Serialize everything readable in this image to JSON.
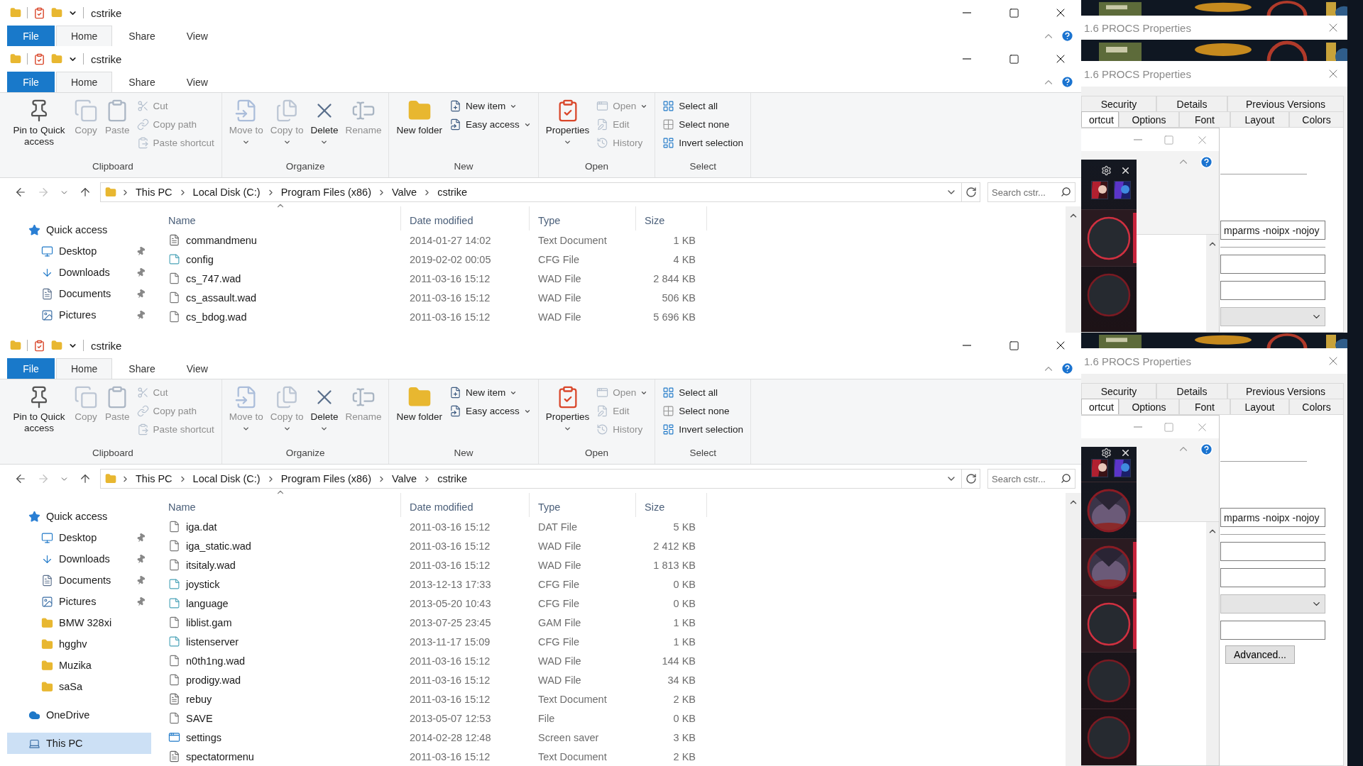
{
  "explorers": [
    {
      "title": "cstrike",
      "tabs": [
        {
          "label": "File",
          "kind": "file",
          "selected": false
        },
        {
          "label": "Home",
          "kind": "tab",
          "selected": true
        },
        {
          "label": "Share",
          "kind": "tab",
          "selected": false
        },
        {
          "label": "View",
          "kind": "tab",
          "selected": false
        }
      ]
    },
    {
      "title": "cstrike",
      "tabs": [
        {
          "label": "File",
          "kind": "file",
          "selected": false
        },
        {
          "label": "Home",
          "kind": "tab",
          "selected": true
        },
        {
          "label": "Share",
          "kind": "tab",
          "selected": false
        },
        {
          "label": "View",
          "kind": "tab",
          "selected": false
        }
      ],
      "ribbon": [
        {
          "label": "Clipboard",
          "large": [
            {
              "label": "Pin to Quick access",
              "kind": "pin",
              "disabled": false,
              "dropdown": false
            },
            {
              "label": "Copy",
              "kind": "copy",
              "disabled": true,
              "dropdown": false
            },
            {
              "label": "Paste",
              "kind": "paste",
              "disabled": true,
              "dropdown": false
            }
          ],
          "small": [
            {
              "label": "Cut",
              "kind": "cut",
              "disabled": true,
              "dropdown": false
            },
            {
              "label": "Copy path",
              "kind": "copypath",
              "disabled": true,
              "dropdown": false
            },
            {
              "label": "Paste shortcut",
              "kind": "shortcut",
              "disabled": true,
              "dropdown": false
            }
          ]
        },
        {
          "label": "Organize",
          "large": [
            {
              "label": "Move to",
              "kind": "moveto",
              "disabled": true,
              "dropdown": true
            },
            {
              "label": "Copy to",
              "kind": "copyto",
              "disabled": true,
              "dropdown": true
            },
            {
              "label": "Delete",
              "kind": "delete",
              "disabled": false,
              "dropdown": true
            },
            {
              "label": "Rename",
              "kind": "rename",
              "disabled": true,
              "dropdown": false
            }
          ]
        },
        {
          "label": "New",
          "large": [
            {
              "label": "New folder",
              "kind": "newfolder",
              "disabled": false,
              "dropdown": false
            }
          ],
          "small": [
            {
              "label": "New item",
              "kind": "newitem",
              "disabled": false,
              "dropdown": true
            },
            {
              "label": "Easy access",
              "kind": "easyaccess",
              "disabled": false,
              "dropdown": true
            }
          ]
        },
        {
          "label": "Open",
          "large": [
            {
              "label": "Properties",
              "kind": "properties",
              "disabled": false,
              "dropdown": true
            }
          ],
          "small": [
            {
              "label": "Open",
              "kind": "open",
              "disabled": true,
              "dropdown": true
            },
            {
              "label": "Edit",
              "kind": "edit",
              "disabled": true,
              "dropdown": false
            },
            {
              "label": "History",
              "kind": "history",
              "disabled": true,
              "dropdown": false
            }
          ]
        },
        {
          "label": "Select",
          "small": [
            {
              "label": "Select all",
              "kind": "selectall",
              "disabled": false,
              "dropdown": false
            },
            {
              "label": "Select none",
              "kind": "selectnone",
              "disabled": false,
              "dropdown": false
            },
            {
              "label": "Invert selection",
              "kind": "invert",
              "disabled": false,
              "dropdown": false
            }
          ]
        }
      ],
      "nav_buttons": [
        {
          "kind": "back",
          "disabled": false
        },
        {
          "kind": "forward",
          "disabled": true
        },
        {
          "kind": "recent",
          "disabled": false
        },
        {
          "kind": "up",
          "disabled": false
        }
      ],
      "crumbs": [
        "This PC",
        "Local Disk (C:)",
        "Program Files (x86)",
        "Valve",
        "cstrike"
      ],
      "search_placeholder": "Search cstr...",
      "nav": [
        {
          "label": "Quick access",
          "kind": "star",
          "pinned": false,
          "selected": false,
          "children": [
            {
              "label": "Desktop",
              "kind": "desktop",
              "pinned": true,
              "selected": false
            },
            {
              "label": "Downloads",
              "kind": "downloads",
              "pinned": true,
              "selected": false
            },
            {
              "label": "Documents",
              "kind": "documents",
              "pinned": true,
              "selected": false
            },
            {
              "label": "Pictures",
              "kind": "pictures",
              "pinned": true,
              "selected": false
            }
          ]
        }
      ],
      "columns": [
        {
          "label": "Name",
          "sorted": true
        },
        {
          "label": "Date modified",
          "sorted": false
        },
        {
          "label": "Type",
          "sorted": false
        },
        {
          "label": "Size",
          "sorted": false
        }
      ],
      "rows": [
        {
          "name": "commandmenu",
          "date": "2014-01-27 14:02",
          "type": "Text Document",
          "size": "1 KB",
          "kind": "text"
        },
        {
          "name": "config",
          "date": "2019-02-02 00:05",
          "type": "CFG File",
          "size": "4 KB",
          "kind": "cfg"
        },
        {
          "name": "cs_747.wad",
          "date": "2011-03-16 15:12",
          "type": "WAD File",
          "size": "2 844 KB",
          "kind": "file"
        },
        {
          "name": "cs_assault.wad",
          "date": "2011-03-16 15:12",
          "type": "WAD File",
          "size": "506 KB",
          "kind": "file"
        },
        {
          "name": "cs_bdog.wad",
          "date": "2011-03-16 15:12",
          "type": "WAD File",
          "size": "5 696 KB",
          "kind": "file"
        }
      ]
    },
    {
      "title": "cstrike",
      "tabs": [
        {
          "label": "File",
          "kind": "file",
          "selected": false
        },
        {
          "label": "Home",
          "kind": "tab",
          "selected": true
        },
        {
          "label": "Share",
          "kind": "tab",
          "selected": false
        },
        {
          "label": "View",
          "kind": "tab",
          "selected": false
        }
      ],
      "ribbon": [
        {
          "label": "Clipboard",
          "large": [
            {
              "label": "Pin to Quick access",
              "kind": "pin",
              "disabled": false,
              "dropdown": false
            },
            {
              "label": "Copy",
              "kind": "copy",
              "disabled": true,
              "dropdown": false
            },
            {
              "label": "Paste",
              "kind": "paste",
              "disabled": true,
              "dropdown": false
            }
          ],
          "small": [
            {
              "label": "Cut",
              "kind": "cut",
              "disabled": true,
              "dropdown": false
            },
            {
              "label": "Copy path",
              "kind": "copypath",
              "disabled": true,
              "dropdown": false
            },
            {
              "label": "Paste shortcut",
              "kind": "shortcut",
              "disabled": true,
              "dropdown": false
            }
          ]
        },
        {
          "label": "Organize",
          "large": [
            {
              "label": "Move to",
              "kind": "moveto",
              "disabled": true,
              "dropdown": true
            },
            {
              "label": "Copy to",
              "kind": "copyto",
              "disabled": true,
              "dropdown": true
            },
            {
              "label": "Delete",
              "kind": "delete",
              "disabled": false,
              "dropdown": true
            },
            {
              "label": "Rename",
              "kind": "rename",
              "disabled": true,
              "dropdown": false
            }
          ]
        },
        {
          "label": "New",
          "large": [
            {
              "label": "New folder",
              "kind": "newfolder",
              "disabled": false,
              "dropdown": false
            }
          ],
          "small": [
            {
              "label": "New item",
              "kind": "newitem",
              "disabled": false,
              "dropdown": true
            },
            {
              "label": "Easy access",
              "kind": "easyaccess",
              "disabled": false,
              "dropdown": true
            }
          ]
        },
        {
          "label": "Open",
          "large": [
            {
              "label": "Properties",
              "kind": "properties",
              "disabled": false,
              "dropdown": true
            }
          ],
          "small": [
            {
              "label": "Open",
              "kind": "open",
              "disabled": true,
              "dropdown": true
            },
            {
              "label": "Edit",
              "kind": "edit",
              "disabled": true,
              "dropdown": false
            },
            {
              "label": "History",
              "kind": "history",
              "disabled": true,
              "dropdown": false
            }
          ]
        },
        {
          "label": "Select",
          "small": [
            {
              "label": "Select all",
              "kind": "selectall",
              "disabled": false,
              "dropdown": false
            },
            {
              "label": "Select none",
              "kind": "selectnone",
              "disabled": false,
              "dropdown": false
            },
            {
              "label": "Invert selection",
              "kind": "invert",
              "disabled": false,
              "dropdown": false
            }
          ]
        }
      ],
      "nav_buttons": [
        {
          "kind": "back",
          "disabled": false
        },
        {
          "kind": "forward",
          "disabled": true
        },
        {
          "kind": "recent",
          "disabled": false
        },
        {
          "kind": "up",
          "disabled": false
        }
      ],
      "crumbs": [
        "This PC",
        "Local Disk (C:)",
        "Program Files (x86)",
        "Valve",
        "cstrike"
      ],
      "search_placeholder": "Search cstr...",
      "nav": [
        {
          "label": "Quick access",
          "kind": "star",
          "pinned": false,
          "selected": false,
          "children": [
            {
              "label": "Desktop",
              "kind": "desktop",
              "pinned": true,
              "selected": false
            },
            {
              "label": "Downloads",
              "kind": "downloads",
              "pinned": true,
              "selected": false
            },
            {
              "label": "Documents",
              "kind": "documents",
              "pinned": true,
              "selected": false
            },
            {
              "label": "Pictures",
              "kind": "pictures",
              "pinned": true,
              "selected": false
            },
            {
              "label": "BMW 328xi",
              "kind": "folder",
              "pinned": false,
              "selected": false
            },
            {
              "label": "hgghv",
              "kind": "folder",
              "pinned": false,
              "selected": false
            },
            {
              "label": "Muzika",
              "kind": "folder",
              "pinned": false,
              "selected": false
            },
            {
              "label": "saSa",
              "kind": "folder",
              "pinned": false,
              "selected": false
            }
          ]
        },
        {
          "label": "OneDrive",
          "kind": "cloud",
          "pinned": false,
          "selected": false
        },
        {
          "label": "This PC",
          "kind": "pc",
          "pinned": false,
          "selected": true
        }
      ],
      "columns": [
        {
          "label": "Name",
          "sorted": true
        },
        {
          "label": "Date modified",
          "sorted": false
        },
        {
          "label": "Type",
          "sorted": false
        },
        {
          "label": "Size",
          "sorted": false
        }
      ],
      "rows": [
        {
          "name": "iga.dat",
          "date": "2011-03-16 15:12",
          "type": "DAT File",
          "size": "5 KB",
          "kind": "file"
        },
        {
          "name": "iga_static.wad",
          "date": "2011-03-16 15:12",
          "type": "WAD File",
          "size": "2 412 KB",
          "kind": "file"
        },
        {
          "name": "itsitaly.wad",
          "date": "2011-03-16 15:12",
          "type": "WAD File",
          "size": "1 813 KB",
          "kind": "file"
        },
        {
          "name": "joystick",
          "date": "2013-12-13 17:33",
          "type": "CFG File",
          "size": "0 KB",
          "kind": "cfg"
        },
        {
          "name": "language",
          "date": "2013-05-20 10:43",
          "type": "CFG File",
          "size": "0 KB",
          "kind": "cfg"
        },
        {
          "name": "liblist.gam",
          "date": "2013-07-25 23:45",
          "type": "GAM File",
          "size": "1 KB",
          "kind": "file"
        },
        {
          "name": "listenserver",
          "date": "2013-11-17 15:09",
          "type": "CFG File",
          "size": "1 KB",
          "kind": "cfg"
        },
        {
          "name": "n0th1ng.wad",
          "date": "2011-03-16 15:12",
          "type": "WAD File",
          "size": "144 KB",
          "kind": "file"
        },
        {
          "name": "prodigy.wad",
          "date": "2011-03-16 15:12",
          "type": "WAD File",
          "size": "34 KB",
          "kind": "file"
        },
        {
          "name": "rebuy",
          "date": "2011-03-16 15:12",
          "type": "Text Document",
          "size": "2 KB",
          "kind": "text"
        },
        {
          "name": "SAVE",
          "date": "2013-05-07 12:53",
          "type": "File",
          "size": "0 KB",
          "kind": "file"
        },
        {
          "name": "settings",
          "date": "2014-02-28 12:48",
          "type": "Screen saver",
          "size": "3 KB",
          "kind": "screensaver"
        },
        {
          "name": "spectatormenu",
          "date": "2011-03-16 15:12",
          "type": "Text Document",
          "size": "2 KB",
          "kind": "text"
        }
      ]
    }
  ],
  "properties_panels": [
    {
      "titles": [
        "1.6 PROCS Properties",
        "1.6 PROCS Properties"
      ],
      "tab_rows": [
        [
          {
            "label": "Security",
            "selected": false
          },
          {
            "label": "Details",
            "selected": false
          },
          {
            "label": "Previous Versions",
            "selected": false
          }
        ],
        [
          {
            "label": "ortcut",
            "selected": true
          },
          {
            "label": "Options",
            "selected": false
          },
          {
            "label": "Font",
            "selected": false
          },
          {
            "label": "Layout",
            "selected": false
          },
          {
            "label": "Colors",
            "selected": false
          }
        ]
      ],
      "fields": [
        {
          "kind": "text",
          "value": "mparms -noipx -nojoy"
        },
        {
          "kind": "text"
        },
        {
          "kind": "text"
        },
        {
          "kind": "dropdown"
        }
      ],
      "slots": [
        {
          "kind": "empty",
          "highlighted": true
        },
        {
          "kind": "empty",
          "highlighted": false
        }
      ]
    },
    {
      "titles": [
        "1.6 PROCS Properties"
      ],
      "tab_rows": [
        [
          {
            "label": "Security",
            "selected": false
          },
          {
            "label": "Details",
            "selected": false
          },
          {
            "label": "Previous Versions",
            "selected": false
          }
        ],
        [
          {
            "label": "ortcut",
            "selected": true
          },
          {
            "label": "Options",
            "selected": false
          },
          {
            "label": "Font",
            "selected": false
          },
          {
            "label": "Layout",
            "selected": false
          },
          {
            "label": "Colors",
            "selected": false
          }
        ]
      ],
      "fields": [
        {
          "kind": "text",
          "value": "mparms -noipx -nojoy"
        },
        {
          "kind": "text"
        },
        {
          "kind": "text"
        },
        {
          "kind": "dropdown"
        },
        {
          "kind": "text"
        },
        {
          "kind": "button",
          "label": "Advanced..."
        }
      ],
      "slots": [
        {
          "kind": "portrait",
          "highlighted": false
        },
        {
          "kind": "portrait",
          "highlighted": true
        },
        {
          "kind": "empty",
          "highlighted": true
        },
        {
          "kind": "empty",
          "highlighted": false
        },
        {
          "kind": "empty",
          "highlighted": false
        }
      ]
    }
  ]
}
